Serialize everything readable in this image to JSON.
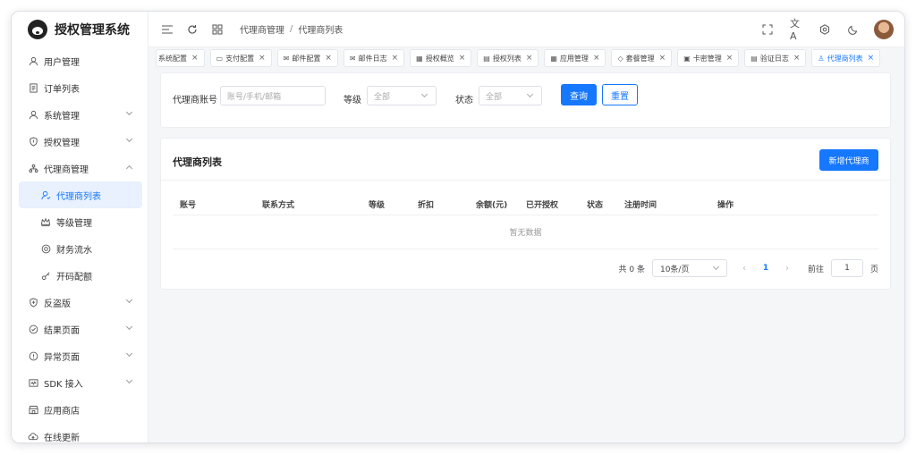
{
  "app": {
    "title": "授权管理系统"
  },
  "sidebar": {
    "items": [
      {
        "label": "用户管理",
        "icon": "user-icon"
      },
      {
        "label": "订单列表",
        "icon": "document-icon"
      },
      {
        "label": "系统管理",
        "icon": "user-settings-icon"
      },
      {
        "label": "授权管理",
        "icon": "shield-icon"
      },
      {
        "label": "代理商管理",
        "icon": "org-icon"
      }
    ],
    "sub_items": [
      {
        "label": "代理商列表",
        "icon": "user-check-icon"
      },
      {
        "label": "等级管理",
        "icon": "crown-icon"
      },
      {
        "label": "财务流水",
        "icon": "coin-icon"
      },
      {
        "label": "开码配额",
        "icon": "key-icon"
      }
    ],
    "bottom_items": [
      {
        "label": "反盗版",
        "icon": "shield-plus-icon"
      },
      {
        "label": "结果页面",
        "icon": "check-circle-icon"
      },
      {
        "label": "异常页面",
        "icon": "alert-circle-icon"
      },
      {
        "label": "SDK 接入",
        "icon": "code-icon"
      },
      {
        "label": "应用商店",
        "icon": "store-icon"
      },
      {
        "label": "在线更新",
        "icon": "cloud-icon"
      }
    ]
  },
  "breadcrumb": {
    "parent": "代理商管理",
    "separator": "/",
    "current": "代理商列表"
  },
  "tabs": [
    {
      "label": "系统配置"
    },
    {
      "label": "支付配置"
    },
    {
      "label": "邮件配置"
    },
    {
      "label": "邮件日志"
    },
    {
      "label": "授权概览"
    },
    {
      "label": "授权列表"
    },
    {
      "label": "应用管理"
    },
    {
      "label": "套餐管理"
    },
    {
      "label": "卡密管理"
    },
    {
      "label": "验证日志"
    },
    {
      "label": "代理商列表"
    }
  ],
  "filter": {
    "account_label": "代理商账号",
    "account_placeholder": "账号/手机/邮箱",
    "level_label": "等级",
    "level_value": "全部",
    "status_label": "状态",
    "status_value": "全部",
    "query_button": "查询",
    "reset_button": "重置"
  },
  "list": {
    "title": "代理商列表",
    "add_button": "新增代理商",
    "columns": [
      "账号",
      "联系方式",
      "等级",
      "折扣",
      "余额(元)",
      "已开授权",
      "状态",
      "注册时间",
      "操作"
    ],
    "empty_text": "暂无数据"
  },
  "pagination": {
    "total_text": "共 0 条",
    "page_size": "10条/页",
    "current_page": "1",
    "goto_label": "前往",
    "goto_value": "1",
    "page_suffix": "页"
  },
  "colors": {
    "primary": "#1677ff",
    "active_bg": "#e8f1fd"
  }
}
